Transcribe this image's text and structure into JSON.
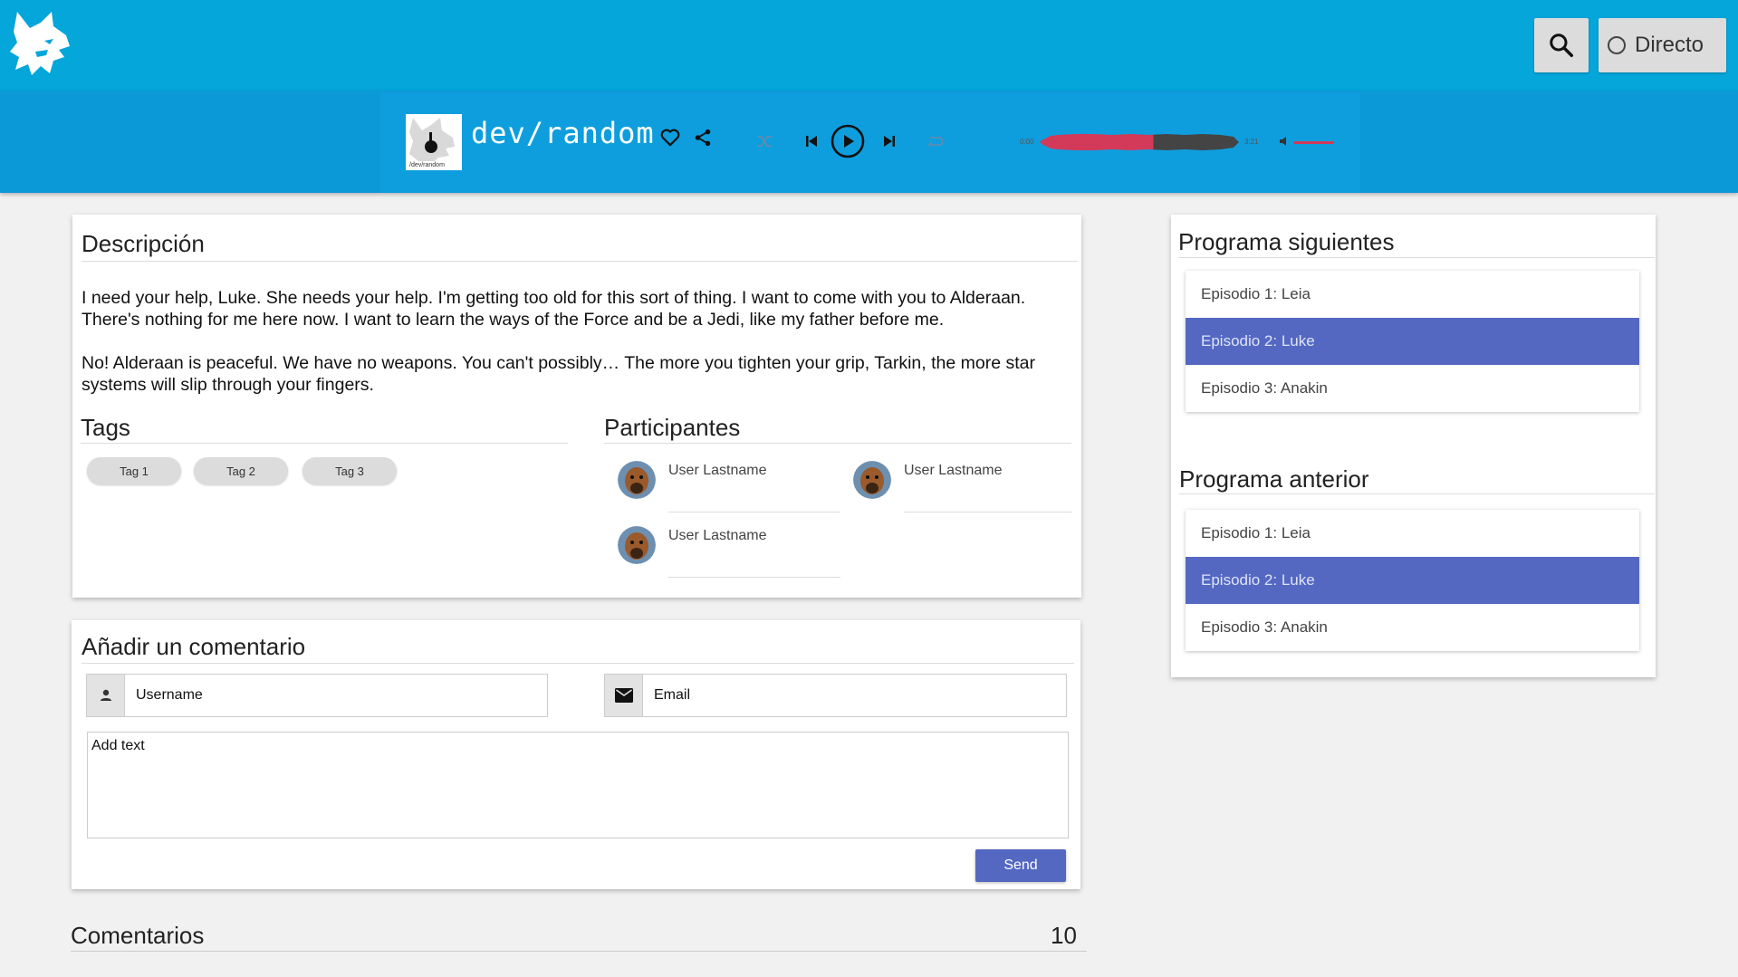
{
  "header": {
    "logo_icon": "lynx-logo-icon",
    "search_icon": "search-icon",
    "live_label": "Directo"
  },
  "player": {
    "cover_caption": "/dev/random",
    "station_title": "dev/random",
    "icons": [
      "heart-icon",
      "share-icon",
      "shuffle-icon",
      "skip-previous-icon",
      "play-icon",
      "skip-next-icon",
      "repeat-icon",
      "volume-icon"
    ],
    "time_elapsed": "0:00",
    "time_total": "3:21",
    "accent_color": "#d33a5a"
  },
  "description": {
    "title": "Descripción",
    "paragraphs": [
      "I need your help, Luke. She needs your help. I'm getting too old for this sort of thing. I want to come with you to Alderaan. There's nothing for me here now. I want to learn the ways of the Force and be a Jedi, like my father before me.",
      "No! Alderaan is peaceful. We have no weapons. You can't possibly… The more you tighten your grip, Tarkin, the more star systems will slip through your fingers."
    ],
    "tags_title": "Tags",
    "tags": [
      "Tag 1",
      "Tag 2",
      "Tag 3"
    ],
    "participants_title": "Participantes",
    "participants": [
      "User Lastname",
      "User Lastname",
      "User Lastname"
    ]
  },
  "comment_form": {
    "title": "Añadir un comentario",
    "username_placeholder": "Username",
    "email_placeholder": "Email",
    "text_placeholder": "Add text",
    "send_label": "Send"
  },
  "comments": {
    "title": "Comentarios",
    "count": "10"
  },
  "next_programs": {
    "title": "Programa siguientes",
    "items": [
      "Episodio 1: Leia",
      "Episodio 2: Luke",
      "Episodio 3: Anakin"
    ],
    "active_index": 1
  },
  "previous_programs": {
    "title": "Programa anterior",
    "items": [
      "Episodio 1: Leia",
      "Episodio 2: Luke",
      "Episodio 3: Anakin"
    ],
    "active_index": 1
  },
  "colors": {
    "topbar": "#05a6da",
    "playerbar": "#0c99d8",
    "primary": "#5468c2"
  }
}
